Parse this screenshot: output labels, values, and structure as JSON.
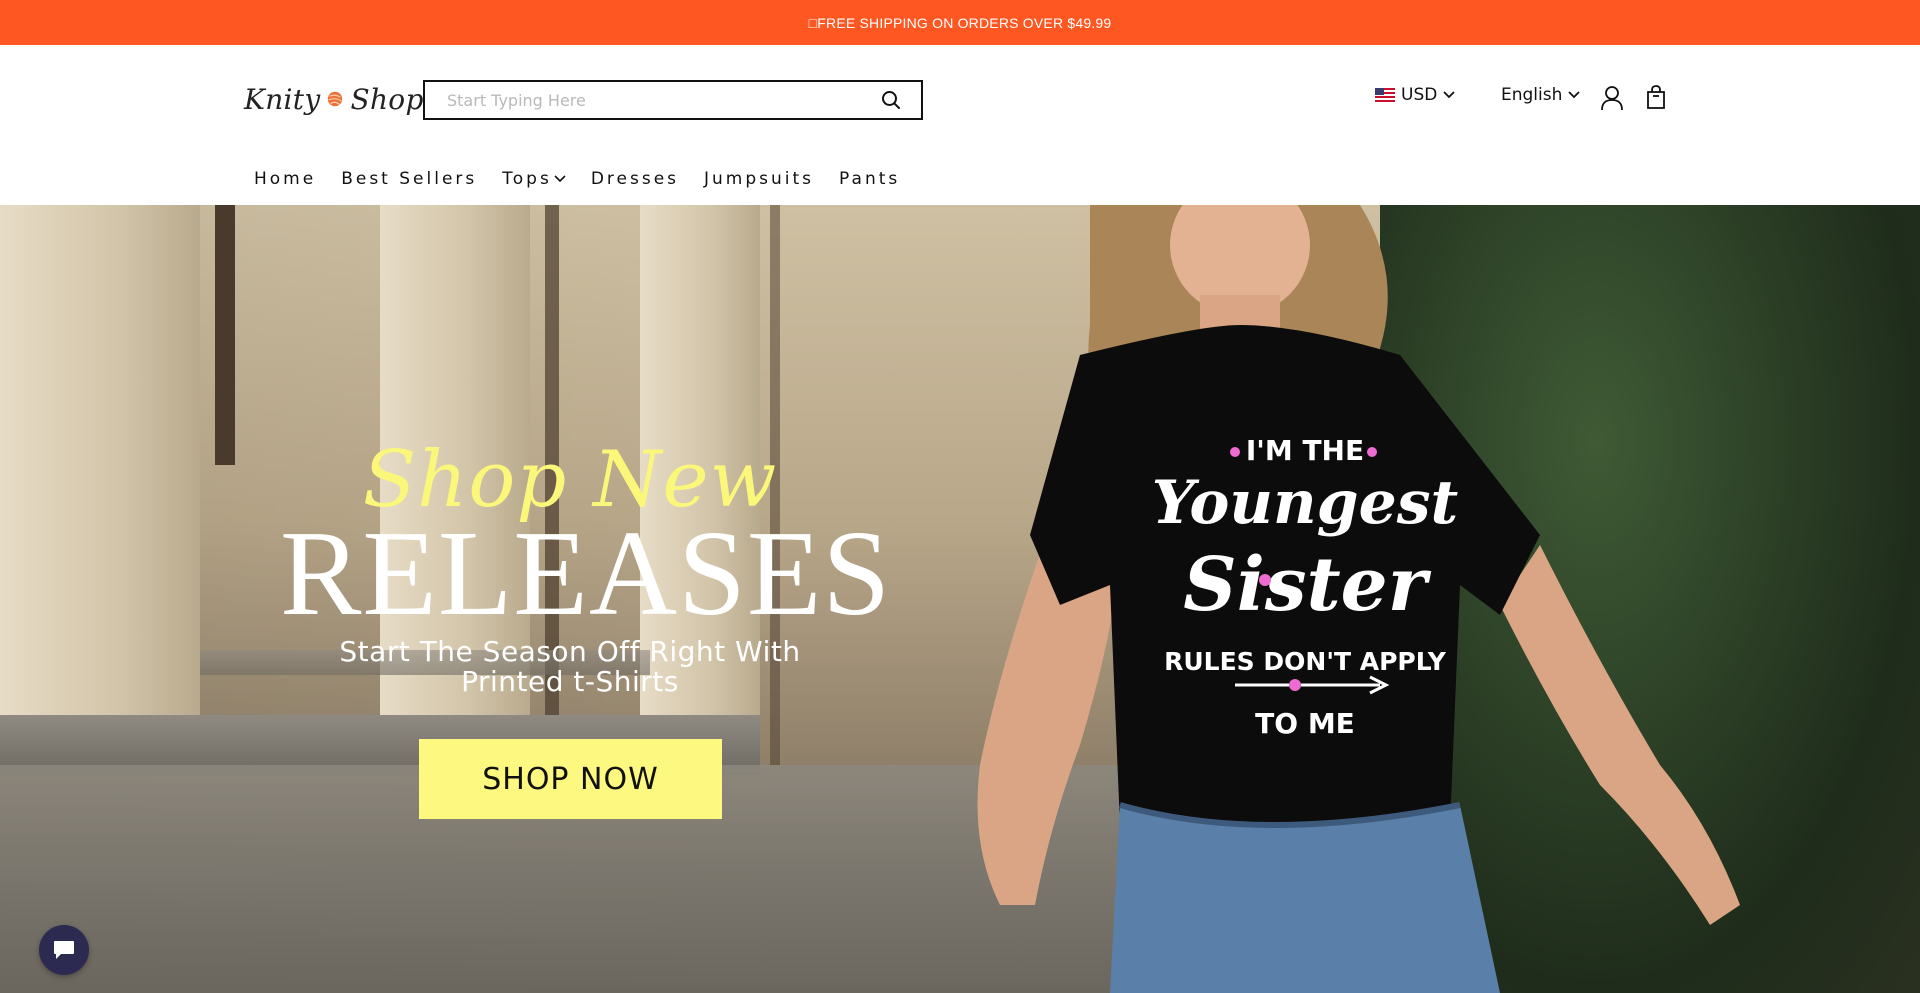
{
  "announcement": {
    "text": "□FREE SHIPPING ON ORDERS OVER $49.99"
  },
  "header": {
    "logo_left": "Knity",
    "logo_right": "Shop",
    "search_placeholder": "Start Typing Here",
    "currency": "USD",
    "language": "English"
  },
  "nav": {
    "items": [
      {
        "label": "Home"
      },
      {
        "label": "Best Sellers"
      },
      {
        "label": "Tops"
      },
      {
        "label": "Dresses"
      },
      {
        "label": "Jumpsuits"
      },
      {
        "label": "Pants"
      }
    ]
  },
  "hero": {
    "script_line": "Shop New",
    "headline": "RELEASES",
    "subline_1": "Start The Season Off Right With",
    "subline_2": "Printed t-Shirts",
    "button": "SHOP NOW",
    "shirt_line_1": "I'M THE",
    "shirt_line_2": "Youngest",
    "shirt_line_3": "Sister",
    "shirt_line_4": "RULES DON'T APPLY",
    "shirt_line_5": "TO ME"
  },
  "colors": {
    "announcement_bg": "#ff5722",
    "accent_yellow": "#fdf980",
    "chat_bg": "#2d2a52"
  },
  "icons": [
    "search-icon",
    "flag-us-icon",
    "chevron-down-icon",
    "account-icon",
    "cart-icon",
    "chat-icon"
  ]
}
